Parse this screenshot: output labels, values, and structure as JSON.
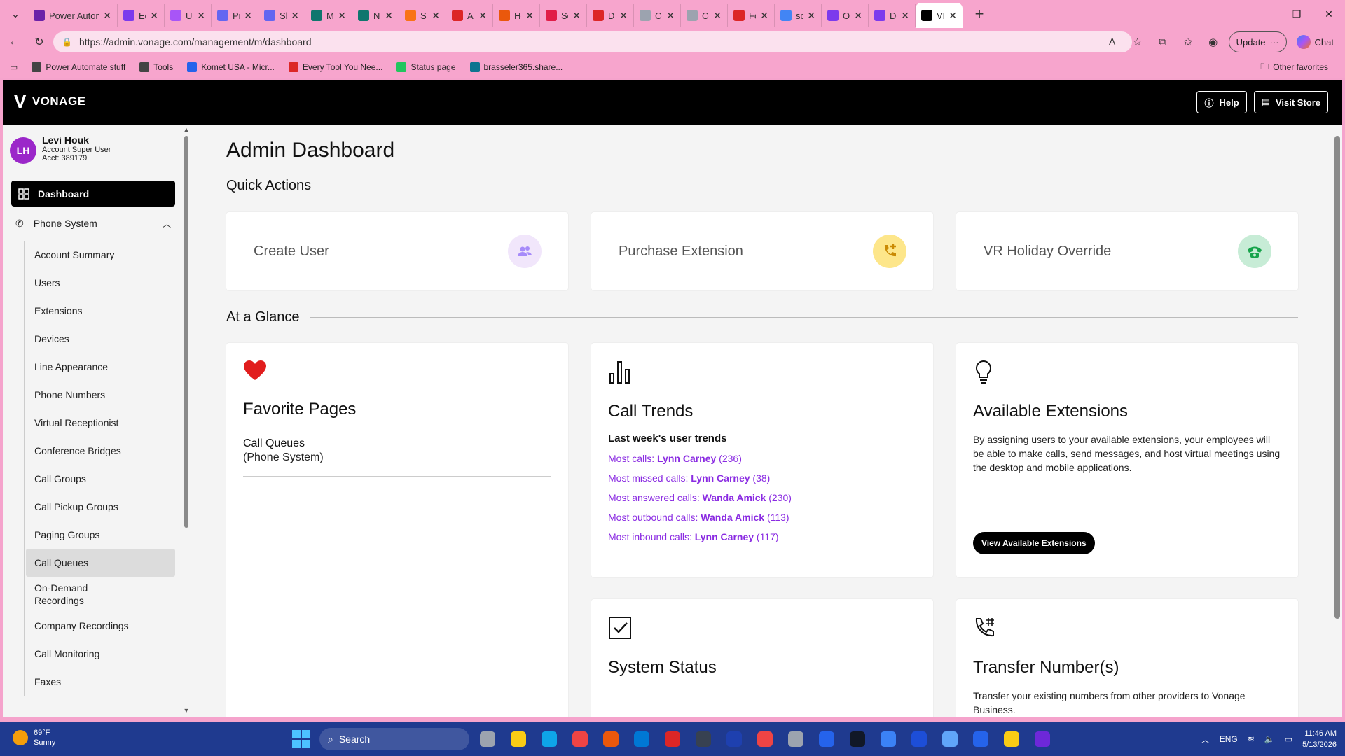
{
  "browser": {
    "tabs": [
      {
        "title": "Power Automate stuff",
        "color": "#6b21a8",
        "active": false
      },
      {
        "title": "Edit",
        "color": "#7c3aed",
        "active": false
      },
      {
        "title": "User",
        "color": "#a855f7",
        "active": false
      },
      {
        "title": "Prom",
        "color": "#6366f1",
        "active": false
      },
      {
        "title": "Shar",
        "color": "#6366f1",
        "active": false
      },
      {
        "title": "Micro",
        "color": "#0f766e",
        "active": false
      },
      {
        "title": "New",
        "color": "#0f766e",
        "active": false
      },
      {
        "title": "Shar",
        "color": "#f97316",
        "active": false
      },
      {
        "title": "Auto",
        "color": "#dc2626",
        "active": false
      },
      {
        "title": "Hou",
        "color": "#ea580c",
        "active": false
      },
      {
        "title": "Serv",
        "color": "#e11d48",
        "active": false
      },
      {
        "title": "DM-",
        "color": "#dc2626",
        "active": false
      },
      {
        "title": "Cont",
        "color": "#9ca3af",
        "active": false
      },
      {
        "title": "Cont",
        "color": "#9ca3af",
        "active": false
      },
      {
        "title": "Forti",
        "color": "#dc2626",
        "active": false
      },
      {
        "title": "scrib",
        "color": "#4285f4",
        "active": false
      },
      {
        "title": "Onbo",
        "color": "#7c3aed",
        "active": false
      },
      {
        "title": "Desk",
        "color": "#7c3aed",
        "active": false
      },
      {
        "title": "VBC A",
        "color": "#000000",
        "active": true
      }
    ],
    "url": "https://admin.vonage.com/management/m/dashboard",
    "update_label": "Update",
    "chat_label": "Chat",
    "bookmarks": [
      {
        "label": "Power Automate stuff",
        "color": "#444"
      },
      {
        "label": "Tools",
        "color": "#444"
      },
      {
        "label": "Komet USA - Micr...",
        "color": "#2563eb"
      },
      {
        "label": "Every Tool You Nee...",
        "color": "#dc2626"
      },
      {
        "label": "Status page",
        "color": "#22c55e"
      },
      {
        "label": "brasseler365.share...",
        "color": "#0e7490"
      }
    ],
    "other_favorites": "Other favorites"
  },
  "header": {
    "brand": "VONAGE",
    "help_label": "Help",
    "store_label": "Visit Store"
  },
  "user": {
    "initials": "LH",
    "name": "Levi Houk",
    "role": "Account Super User",
    "account": "Acct: 389179"
  },
  "sidebar": {
    "dashboard": "Dashboard",
    "phone_system": "Phone System",
    "items": [
      {
        "label": "Account Summary"
      },
      {
        "label": "Users"
      },
      {
        "label": "Extensions"
      },
      {
        "label": "Devices"
      },
      {
        "label": "Line Appearance"
      },
      {
        "label": "Phone Numbers"
      },
      {
        "label": "Virtual Receptionist"
      },
      {
        "label": "Conference Bridges"
      },
      {
        "label": "Call Groups"
      },
      {
        "label": "Call Pickup Groups"
      },
      {
        "label": "Paging Groups"
      },
      {
        "label": "Call Queues",
        "active": true
      },
      {
        "label": "On-Demand Recordings",
        "tall": true
      },
      {
        "label": "Company Recordings"
      },
      {
        "label": "Call Monitoring"
      },
      {
        "label": "Faxes"
      }
    ]
  },
  "main": {
    "title": "Admin Dashboard",
    "quick_actions_title": "Quick Actions",
    "quick_actions": [
      {
        "label": "Create User",
        "icon": "users-icon",
        "bg": "#f1e6fb",
        "fg": "#a78bfa"
      },
      {
        "label": "Purchase Extension",
        "icon": "phone-plus-icon",
        "bg": "#fde68a",
        "fg": "#ca8a04"
      },
      {
        "label": "VR Holiday Override",
        "icon": "phone-icon",
        "bg": "#c7ecd6",
        "fg": "#16a34a"
      }
    ],
    "at_a_glance_title": "At a Glance",
    "favorites": {
      "title": "Favorite Pages",
      "item": "Call Queues",
      "item_sub": "(Phone System)"
    },
    "call_trends": {
      "title": "Call Trends",
      "subtitle": "Last week's user trends",
      "rows": [
        {
          "label": "Most calls: ",
          "name": "Lynn Carney",
          "count": " (236)"
        },
        {
          "label": "Most missed calls: ",
          "name": "Lynn Carney",
          "count": " (38)"
        },
        {
          "label": "Most answered calls: ",
          "name": "Wanda Amick",
          "count": " (230)"
        },
        {
          "label": "Most outbound calls: ",
          "name": "Wanda Amick",
          "count": " (113)"
        },
        {
          "label": "Most inbound calls: ",
          "name": "Lynn Carney",
          "count": " (117)"
        }
      ]
    },
    "available_extensions": {
      "title": "Available Extensions",
      "text": "By assigning users to your available extensions, your employees will be able to make calls, send messages, and host virtual meetings using the desktop and mobile applications.",
      "button": "View Available Extensions"
    },
    "system_status": {
      "title": "System Status"
    },
    "transfer_numbers": {
      "title": "Transfer Number(s)",
      "text": "Transfer your existing numbers from other providers to Vonage Business."
    }
  },
  "taskbar": {
    "temp": "69°F",
    "condition": "Sunny",
    "search": "Search",
    "lang": "ENG",
    "time": "11:46 AM",
    "date": "5/13/2026",
    "apps": [
      "#9ca3af",
      "#facc15",
      "#0ea5e9",
      "#ef4444",
      "#ea580c",
      "#0078d4",
      "#dc2626",
      "#374151",
      "#1e40af",
      "#ef4444",
      "#9ca3af",
      "#2563eb",
      "#111827",
      "#3b82f6",
      "#1d4ed8",
      "#60a5fa",
      "#2563eb",
      "#facc15",
      "#6d28d9"
    ]
  }
}
